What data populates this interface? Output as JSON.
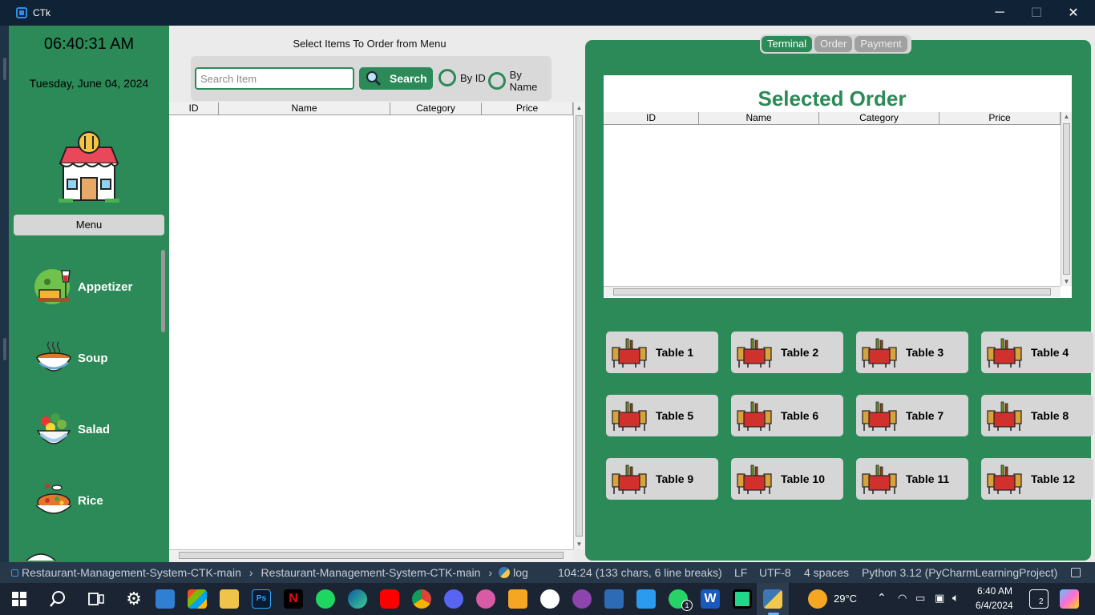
{
  "window": {
    "title": "CTk",
    "min_glyph": "─",
    "max_glyph": "☐",
    "close_glyph": "✕"
  },
  "sidebar": {
    "time": "06:40:31 AM",
    "date": "Tuesday, June 04, 2024",
    "menu_label": "Menu",
    "categories": [
      {
        "label": "Appetizer",
        "icon": "appetizer-icon"
      },
      {
        "label": "Soup",
        "icon": "soup-icon"
      },
      {
        "label": "Salad",
        "icon": "salad-icon"
      },
      {
        "label": "Rice",
        "icon": "rice-icon"
      }
    ]
  },
  "menu": {
    "heading": "Select Items To Order from Menu",
    "search_placeholder": "Search Item",
    "search_value": "",
    "search_button": "Search",
    "radio_by_id": "By ID",
    "radio_by_name": "By Name",
    "columns": [
      "ID",
      "Name",
      "Category",
      "Price"
    ]
  },
  "right": {
    "tabs": [
      {
        "label": "Terminal",
        "active": true
      },
      {
        "label": "Order",
        "active": false
      },
      {
        "label": "Payment",
        "active": false
      }
    ],
    "order_title": "Selected Order",
    "columns": [
      "ID",
      "Name",
      "Category",
      "Price"
    ],
    "tables": [
      "Table 1",
      "Table 2",
      "Table 3",
      "Table 4",
      "Table 5",
      "Table 6",
      "Table 7",
      "Table 8",
      "Table 9",
      "Table 10",
      "Table 11",
      "Table 12"
    ]
  },
  "statusbar": {
    "crumb1": "Restaurant-Management-System-CTK-main",
    "crumb2": "Restaurant-Management-System-CTK-main",
    "crumb3": "log",
    "position": "104:24 (133 chars, 6 line breaks)",
    "line_ending": "LF",
    "encoding": "UTF-8",
    "indent": "4 spaces",
    "interpreter": "Python 3.12 (PyCharmLearningProject)"
  },
  "taskbar": {
    "temperature": "29°C",
    "time": "6:40 AM",
    "date": "6/4/2024",
    "notification_count": "2",
    "whatsapp_badge": "1"
  },
  "colors": {
    "brand_green": "#2b8a57",
    "panel_gray": "#d6d6d6",
    "title_bar": "#0f2236"
  }
}
